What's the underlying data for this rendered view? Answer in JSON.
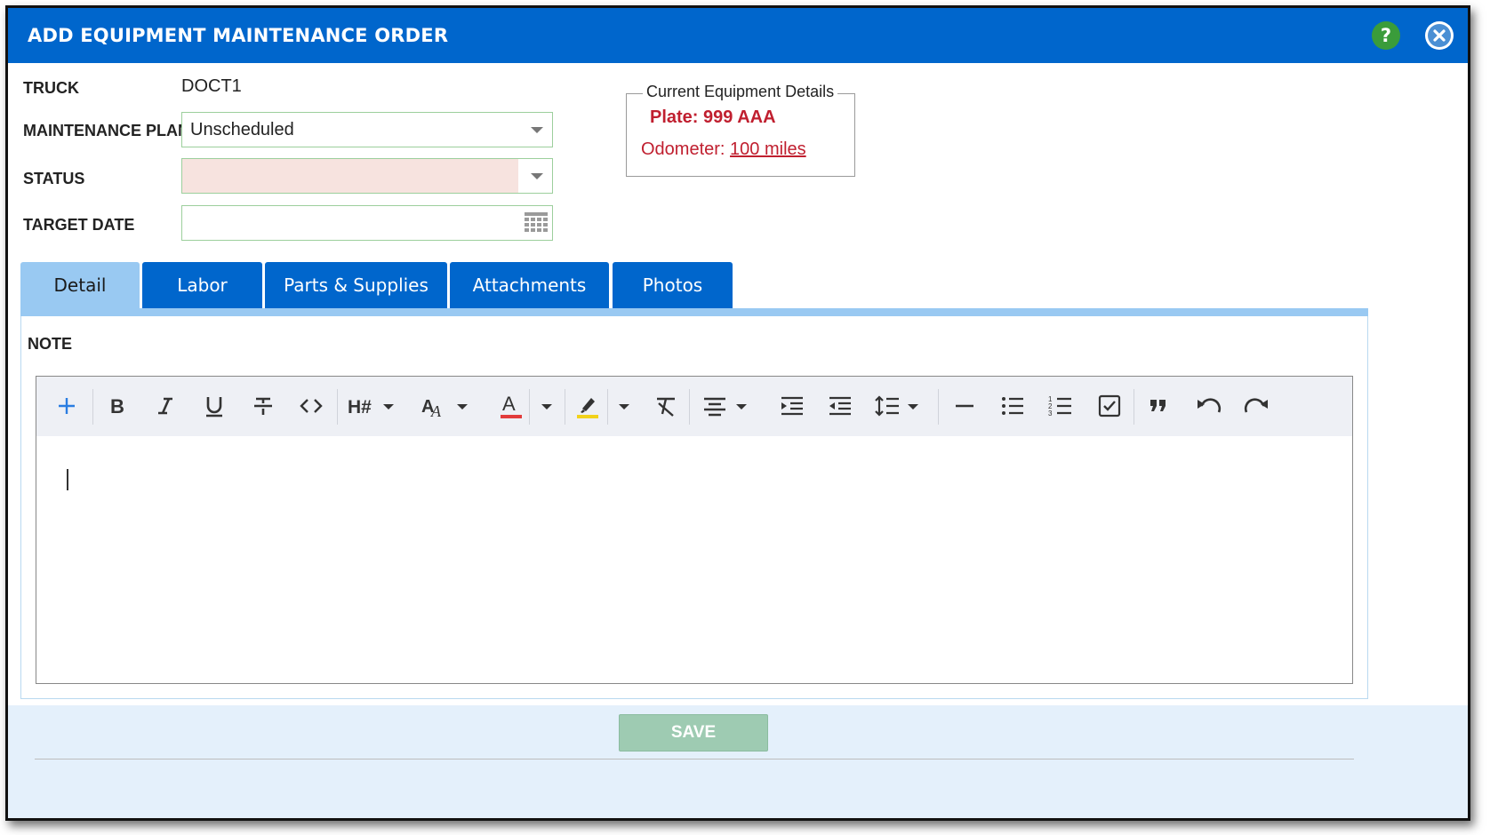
{
  "dialog": {
    "title": "ADD EQUIPMENT MAINTENANCE ORDER",
    "help_label": "?"
  },
  "form": {
    "truck_label": "TRUCK",
    "truck_value": "DOCT1",
    "plan_label": "MAINTENANCE PLAN",
    "plan_value": "Unscheduled",
    "status_label": "STATUS",
    "status_value": "",
    "target_date_label": "TARGET DATE",
    "target_date_value": ""
  },
  "equipment_details": {
    "legend": "Current Equipment Details",
    "plate": "Plate: 999 AAA",
    "odometer_label": "Odometer: ",
    "odometer_value": "100 miles"
  },
  "tabs": [
    {
      "label": "Detail",
      "active": true
    },
    {
      "label": "Labor",
      "active": false
    },
    {
      "label": "Parts & Supplies",
      "active": false
    },
    {
      "label": "Attachments",
      "active": false
    },
    {
      "label": "Photos",
      "active": false
    }
  ],
  "note": {
    "label": "NOTE",
    "content": ""
  },
  "toolbar_icons": [
    "plus-icon",
    "bold-icon",
    "italic-icon",
    "underline-icon",
    "strikethrough-icon",
    "code-icon",
    "heading-icon",
    "font-size-icon",
    "text-color-icon",
    "highlight-icon",
    "clear-format-icon",
    "align-center-icon",
    "indent-icon",
    "outdent-icon",
    "line-height-icon",
    "horizontal-rule-icon",
    "bullet-list-icon",
    "numbered-list-icon",
    "checklist-icon",
    "blockquote-icon",
    "undo-icon",
    "redo-icon"
  ],
  "colors": {
    "header": "#0066cc",
    "tab_active": "#99c9f2",
    "detail_red": "#c01f2f",
    "save_bg": "#9ecbb2",
    "help_green": "#3a9c3a"
  },
  "footer": {
    "save_label": "SAVE"
  }
}
